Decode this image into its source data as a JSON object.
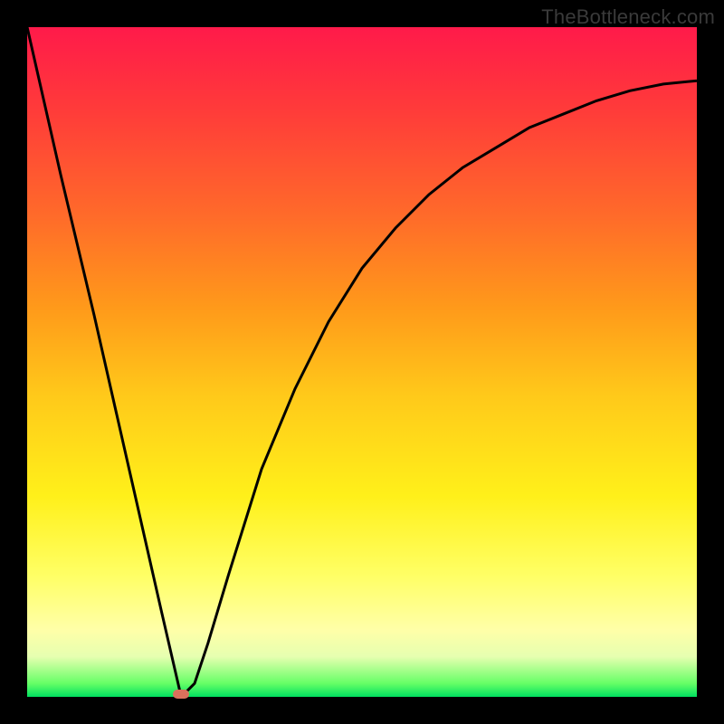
{
  "watermark": "TheBottleneck.com",
  "colors": {
    "background": "#000000",
    "curve_stroke": "#000000",
    "valley_marker": "#d9715c",
    "gradient_top": "#ff1a4a",
    "gradient_mid": "#fff01a",
    "gradient_bottom": "#00e060"
  },
  "chart_data": {
    "type": "line",
    "title": "",
    "xlabel": "",
    "ylabel": "",
    "xlim": [
      0,
      100
    ],
    "ylim": [
      0,
      100
    ],
    "legend": false,
    "grid": false,
    "series": [
      {
        "name": "bottleneck-curve",
        "x": [
          0,
          5,
          10,
          15,
          20,
          23,
          25,
          27,
          30,
          35,
          40,
          45,
          50,
          55,
          60,
          65,
          70,
          75,
          80,
          85,
          90,
          95,
          100
        ],
        "y": [
          100,
          78,
          57,
          35,
          13,
          0,
          2,
          8,
          18,
          34,
          46,
          56,
          64,
          70,
          75,
          79,
          82,
          85,
          87,
          89,
          90.5,
          91.5,
          92
        ]
      }
    ],
    "annotations": [
      {
        "type": "marker",
        "shape": "pill",
        "x": 23,
        "y": 0,
        "color": "#d9715c",
        "name": "valley-marker"
      }
    ]
  }
}
